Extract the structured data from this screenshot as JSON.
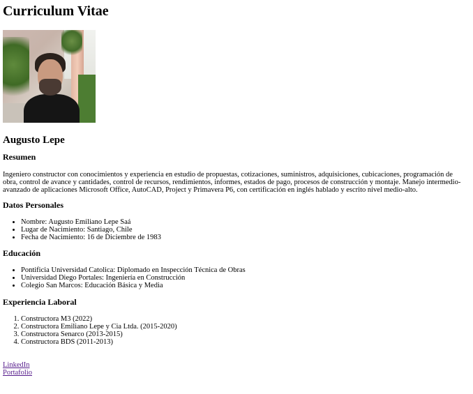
{
  "title": "Curriculum Vitae",
  "name": "Augusto Lepe",
  "resumen": {
    "heading": "Resumen",
    "text": "Ingeniero constructor con conocimientos y experiencia en estudio de propuestas, cotizaciones, suministros, adquisiciones, cubicaciones, programación de obra, control de avance y cantidades, control de recursos, rendimientos, informes, estados de pago, procesos de construcción y montaje. Manejo intermedio-avanzado de aplicaciones Microsoft Office, AutoCAD, Project y Primavera P6, con certificación en inglés hablado y escrito nivel medio-alto."
  },
  "datos_personales": {
    "heading": "Datos Personales",
    "items": [
      "Nombre: Augusto Emiliano Lepe Saá",
      "Lugar de Nacimiento: Santiago, Chile",
      "Fecha de Nacimiento: 16 de Diciembre de 1983"
    ]
  },
  "educacion": {
    "heading": "Educación",
    "items": [
      "Pontificia Universidad Catolica: Diplomado en Inspección Técnica de Obras",
      "Universidad Diego Portales: Ingeniería en Construcción",
      "Colegio San Marcos: Educación Básica y Media"
    ]
  },
  "experiencia": {
    "heading": "Experiencia Laboral",
    "items": [
      "Constructora M3 (2022)",
      "Constructora Emiliano Lepe y Cia Ltda. (2015-2020)",
      "Constructora Senarco (2013-2015)",
      "Constructora BDS (2011-2013)"
    ]
  },
  "links": {
    "linkedin": "LinkedIn",
    "portafolio": "Portafolio"
  },
  "colors": {
    "link_visited": "#551a8b"
  }
}
